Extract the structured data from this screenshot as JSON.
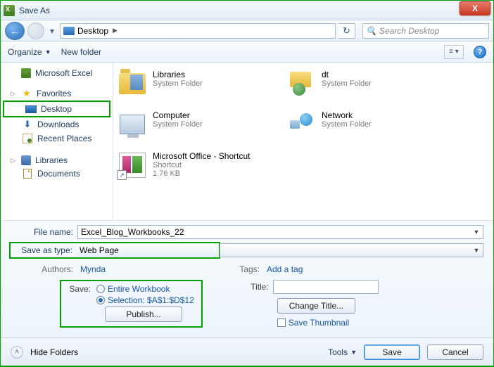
{
  "titlebar": {
    "title": "Save As",
    "close": "X"
  },
  "nav": {
    "location": "Desktop",
    "search_placeholder": "Search Desktop"
  },
  "toolbar": {
    "organize": "Organize",
    "newfolder": "New folder"
  },
  "sidebar": {
    "excel": "Microsoft Excel",
    "favorites": "Favorites",
    "desktop": "Desktop",
    "downloads": "Downloads",
    "recent": "Recent Places",
    "libraries": "Libraries",
    "documents": "Documents"
  },
  "items": {
    "libraries": {
      "name": "Libraries",
      "sub": "System Folder"
    },
    "dt": {
      "name": "dt",
      "sub": "System Folder"
    },
    "computer": {
      "name": "Computer",
      "sub": "System Folder"
    },
    "network": {
      "name": "Network",
      "sub": "System Folder"
    },
    "shortcut": {
      "name": "Microsoft Office - Shortcut",
      "sub1": "Shortcut",
      "sub2": "1.76 KB"
    }
  },
  "form": {
    "filename_label": "File name:",
    "filename_value": "Excel_Blog_Workbooks_22",
    "type_label": "Save as type:",
    "type_value": "Web Page",
    "authors_label": "Authors:",
    "authors_value": "Mynda",
    "tags_label": "Tags:",
    "tags_value": "Add a tag",
    "save_label": "Save:",
    "opt_workbook": "Entire Workbook",
    "opt_selection": "Selection: $A$1:$D$12",
    "publish": "Publish...",
    "title_label": "Title:",
    "change_title": "Change Title...",
    "thumb": "Save Thumbnail"
  },
  "footer": {
    "hide": "Hide Folders",
    "tools": "Tools",
    "save": "Save",
    "cancel": "Cancel"
  }
}
